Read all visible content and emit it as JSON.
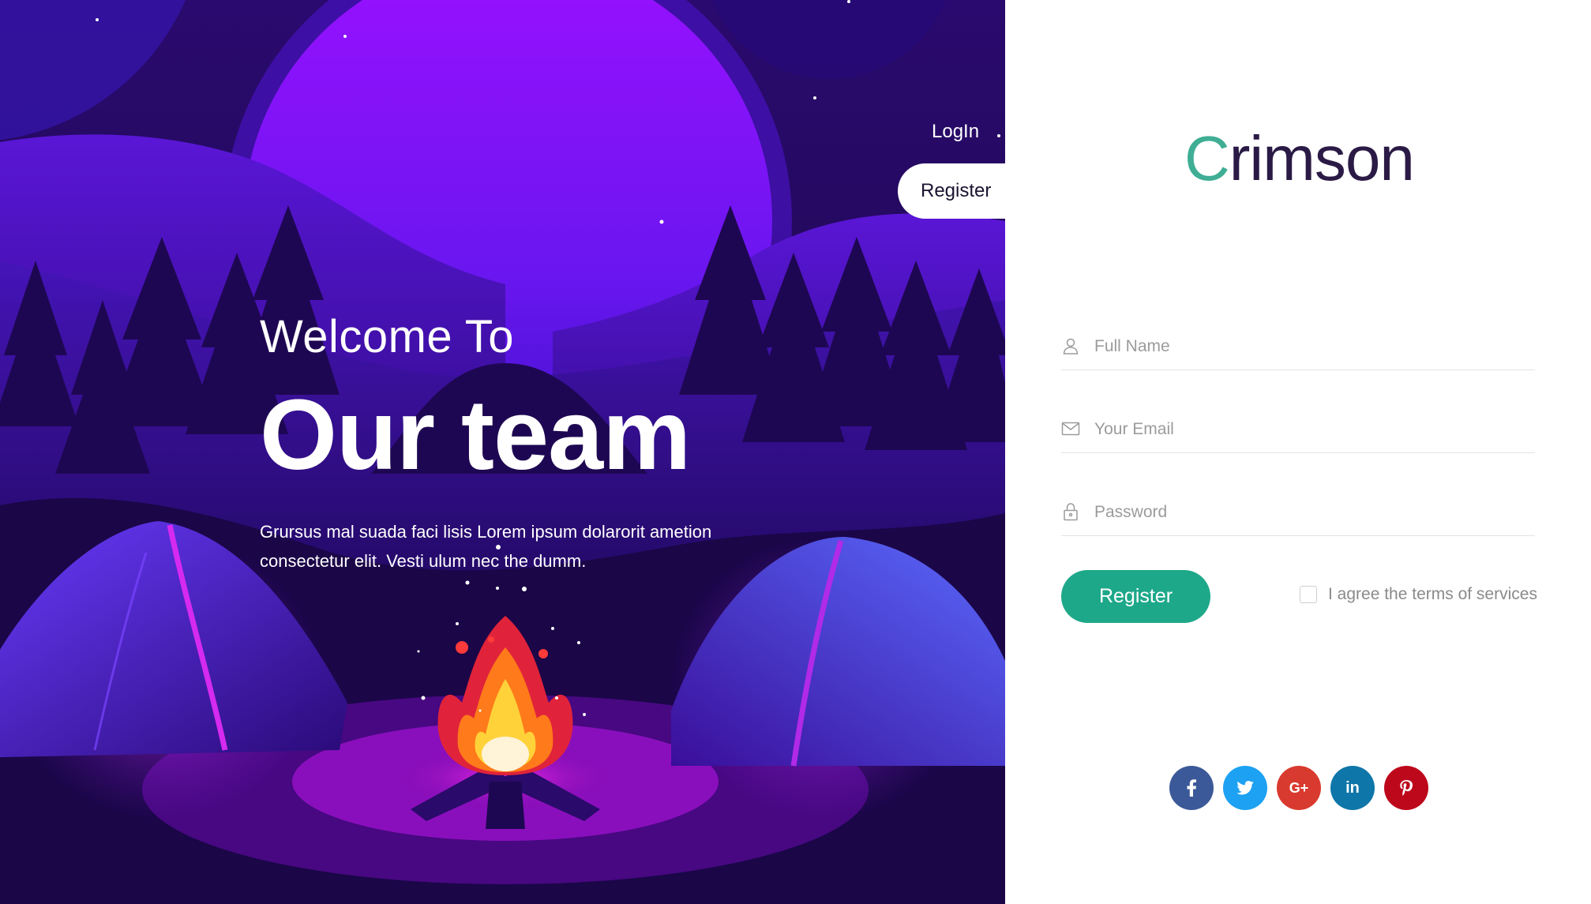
{
  "hero": {
    "welcome": "Welcome To",
    "headline": "Our team",
    "description": "Grursus mal suada faci lisis Lorem ipsum dolarorit ametion consectetur elit. Vesti ulum nec the dumm."
  },
  "tabs": {
    "login": "LogIn",
    "register": "Register",
    "active": "register"
  },
  "brand": {
    "first_letter": "C",
    "rest": "rimson",
    "accent": "#3fae94",
    "text": "#2a1a45"
  },
  "form": {
    "fullname": {
      "placeholder": "Full Name",
      "value": "",
      "icon": "user-icon"
    },
    "email": {
      "placeholder": "Your Email",
      "value": "",
      "icon": "mail-icon"
    },
    "password": {
      "placeholder": "Password",
      "value": "",
      "icon": "lock-icon"
    },
    "submit_label": "Register",
    "submit_color": "#1ea88a",
    "agree_label": "I agree the terms of services",
    "agree_checked": false
  },
  "social": [
    {
      "name": "facebook",
      "glyph": "f",
      "color": "#3b5998"
    },
    {
      "name": "twitter",
      "glyph": "twitter-bird",
      "color": "#1da1f2"
    },
    {
      "name": "google-plus",
      "glyph": "G+",
      "color": "#d93a2f"
    },
    {
      "name": "linkedin",
      "glyph": "in",
      "color": "#0e76a8"
    },
    {
      "name": "pinterest",
      "glyph": "P",
      "color": "#bd081c"
    }
  ]
}
